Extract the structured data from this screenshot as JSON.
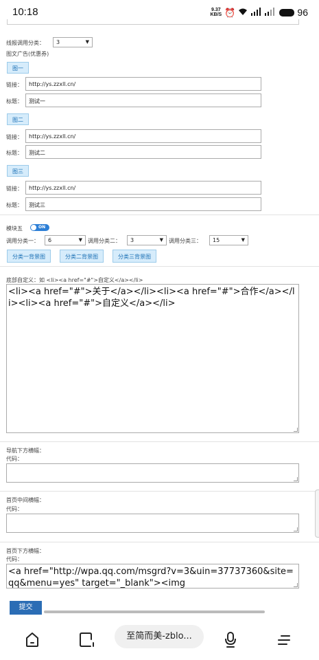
{
  "status_bar": {
    "time": "10:18",
    "speed_value": "9.37",
    "speed_unit": "KB/S",
    "battery": "96"
  },
  "form": {
    "line_category_label": "线报调用分类：",
    "line_category_value": "3",
    "image_ad_label": "图文广告(优惠券)",
    "ads": [
      {
        "tab": "图一",
        "link_label": "链接：",
        "link_value": "http://ys.zzxll.cn/",
        "title_label": "标题：",
        "title_value": "测试一"
      },
      {
        "tab": "图二",
        "link_label": "链接：",
        "link_value": "http://ys.zzxll.cn/",
        "title_label": "标题：",
        "title_value": "测试二"
      },
      {
        "tab": "图三",
        "link_label": "链接：",
        "link_value": "http://ys.zzxll.cn/",
        "title_label": "标题：",
        "title_value": "测试三"
      }
    ],
    "module5_label": "模块五",
    "module5_toggle": "ON",
    "cat1_label": "调用分类一：",
    "cat1_value": "6",
    "cat2_label": "调用分类二：",
    "cat2_value": "3",
    "cat3_label": "调用分类三：",
    "cat3_value": "15",
    "bg_buttons": [
      "分类一背景图",
      "分类二背景图",
      "分类三背景图"
    ],
    "footer_label": "底部自定义：如 <li><a href=\"#\">自定义</a></li>",
    "footer_value": "<li><a href=\"#\">关于</a></li><li><a href=\"#\">合作</a></li><li><a href=\"#\">自定义</a></li>",
    "nav_banner_label": "导航下方横幅：",
    "code_label": "代码：",
    "nav_banner_value": "",
    "home_mid_label": "首页中间横幅：",
    "home_mid_value": "",
    "home_bottom_label": "首页下方横幅：",
    "home_bottom_value": "<a href=\"http://wpa.qq.com/msgrd?v=3&uin=37737360&site=qq&menu=yes\" target=\"_blank\"><img",
    "submit_label": "提交"
  },
  "nav_bar": {
    "pill_text": "至简而美-zblo..."
  },
  "icons": {
    "home": "home-icon",
    "tabs": "tabs-icon",
    "mic": "microphone-icon",
    "menu": "menu-icon"
  }
}
